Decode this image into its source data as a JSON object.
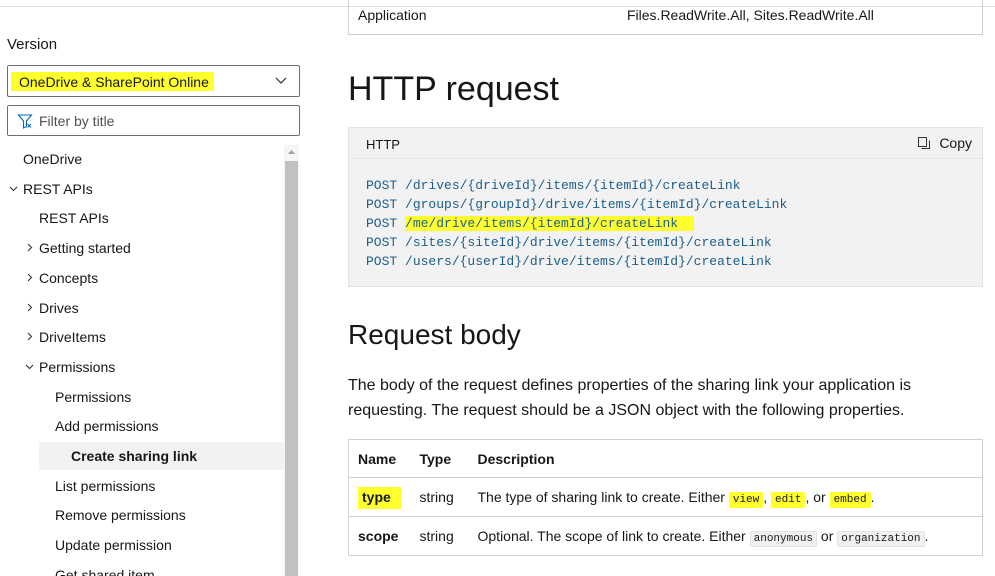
{
  "colors": {
    "highlight": "#ffff2e",
    "code_text": "#1c5e8a",
    "active_bg": "#f2f2f2"
  },
  "sidebar": {
    "version_label": "Version",
    "version_value": "OneDrive & SharePoint Online",
    "filter_placeholder": "Filter by title",
    "toc": [
      {
        "label": "OneDrive",
        "level": 0,
        "twisty": ""
      },
      {
        "label": "REST APIs",
        "level": 0,
        "twisty": "expanded"
      },
      {
        "label": "REST APIs",
        "level": 1,
        "twisty": ""
      },
      {
        "label": "Getting started",
        "level": 1,
        "twisty": "collapsed"
      },
      {
        "label": "Concepts",
        "level": 1,
        "twisty": "collapsed"
      },
      {
        "label": "Drives",
        "level": 1,
        "twisty": "collapsed"
      },
      {
        "label": "DriveItems",
        "level": 1,
        "twisty": "collapsed"
      },
      {
        "label": "Permissions",
        "level": 1,
        "twisty": "expanded"
      },
      {
        "label": "Permissions",
        "level": 2,
        "twisty": ""
      },
      {
        "label": "Add permissions",
        "level": 2,
        "twisty": ""
      },
      {
        "label": "Create sharing link",
        "level": 2,
        "twisty": "",
        "active": true
      },
      {
        "label": "List permissions",
        "level": 2,
        "twisty": ""
      },
      {
        "label": "Remove permissions",
        "level": 2,
        "twisty": ""
      },
      {
        "label": "Update permission",
        "level": 2,
        "twisty": ""
      },
      {
        "label": "Get shared item",
        "level": 2,
        "twisty": ""
      }
    ]
  },
  "main": {
    "permissions_row": {
      "type": "Application",
      "value": "Files.ReadWrite.All, Sites.ReadWrite.All"
    },
    "http_heading": "HTTP request",
    "code": {
      "lang": "HTTP",
      "copy_label": "Copy",
      "lines": [
        {
          "method": "POST",
          "path": "/drives/{driveId}/items/{itemId}/createLink",
          "highlight": false
        },
        {
          "method": "POST",
          "path": "/groups/{groupId}/drive/items/{itemId}/createLink",
          "highlight": false
        },
        {
          "method": "POST",
          "path": "/me/drive/items/{itemId}/createLink",
          "highlight": true
        },
        {
          "method": "POST",
          "path": "/sites/{siteId}/drive/items/{itemId}/createLink",
          "highlight": false
        },
        {
          "method": "POST",
          "path": "/users/{userId}/drive/items/{itemId}/createLink",
          "highlight": false
        }
      ]
    },
    "body_heading": "Request body",
    "body_paragraph": "The body of the request defines properties of the sharing link your application is requesting. The request should be a JSON object with the following properties.",
    "table": {
      "headers": [
        "Name",
        "Type",
        "Description"
      ],
      "rows": [
        {
          "name": "type",
          "type": "string",
          "desc_prefix": "The type of sharing link to create. Either ",
          "codes": [
            "view",
            "edit",
            "embed"
          ],
          "seps": [
            ", ",
            ", or ",
            "."
          ]
        },
        {
          "name": "scope",
          "type": "string",
          "desc_prefix": "Optional. The scope of link to create. Either ",
          "codes": [
            "anonymous",
            "organization"
          ],
          "seps": [
            " or ",
            "."
          ]
        }
      ]
    }
  }
}
